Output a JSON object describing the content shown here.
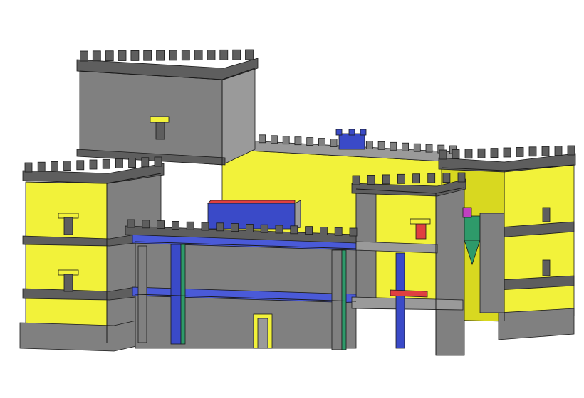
{
  "scene": {
    "background": "#ffffff",
    "subject": "shaded-3d-castle-model",
    "colors": {
      "stone": "#808080",
      "stone_light": "#9a9a9a",
      "stone_dark": "#5e5e5e",
      "wall_face": "#f2f23a",
      "wall_face_shadow": "#d8d820",
      "floor_slab": "#4a5ad8",
      "interior_blue": "#3a4ac8",
      "interior_green": "#2e9a6a",
      "interior_red": "#e04040",
      "interior_magenta": "#c040c0",
      "outline": "#1a1a1a"
    }
  }
}
